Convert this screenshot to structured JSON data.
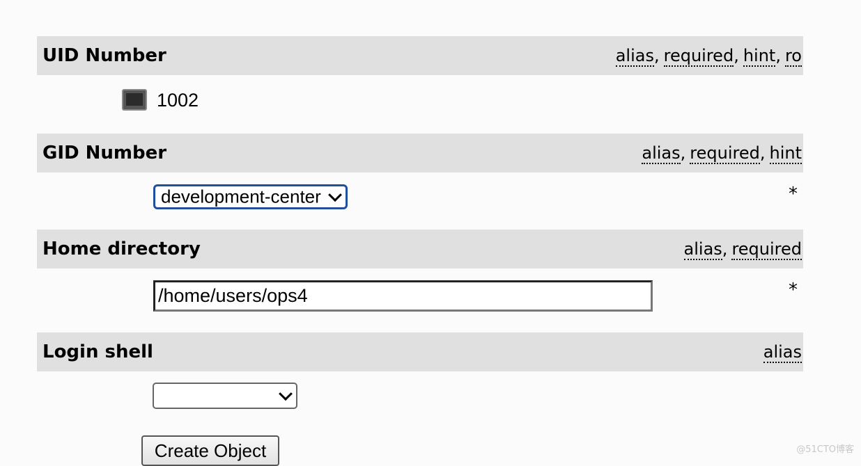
{
  "uid": {
    "title": "UID Number",
    "hints": [
      "alias",
      "required",
      "hint",
      "ro"
    ],
    "value": "1002",
    "icon": "terminal-icon"
  },
  "gid": {
    "title": "GID Number",
    "hints": [
      "alias",
      "required",
      "hint"
    ],
    "selected": "development-center",
    "required_mark": "*"
  },
  "home": {
    "title": "Home directory",
    "hints": [
      "alias",
      "required"
    ],
    "value": "/home/users/ops4",
    "required_mark": "*"
  },
  "shell": {
    "title": "Login shell",
    "hints": [
      "alias"
    ],
    "selected": ""
  },
  "actions": {
    "create_label": "Create Object"
  },
  "watermark": "@51CTO博客",
  "colors": {
    "header_bg": "#e0e0e0",
    "focus_border": "#1f4f9d",
    "page_bg": "#fbfbfb"
  }
}
